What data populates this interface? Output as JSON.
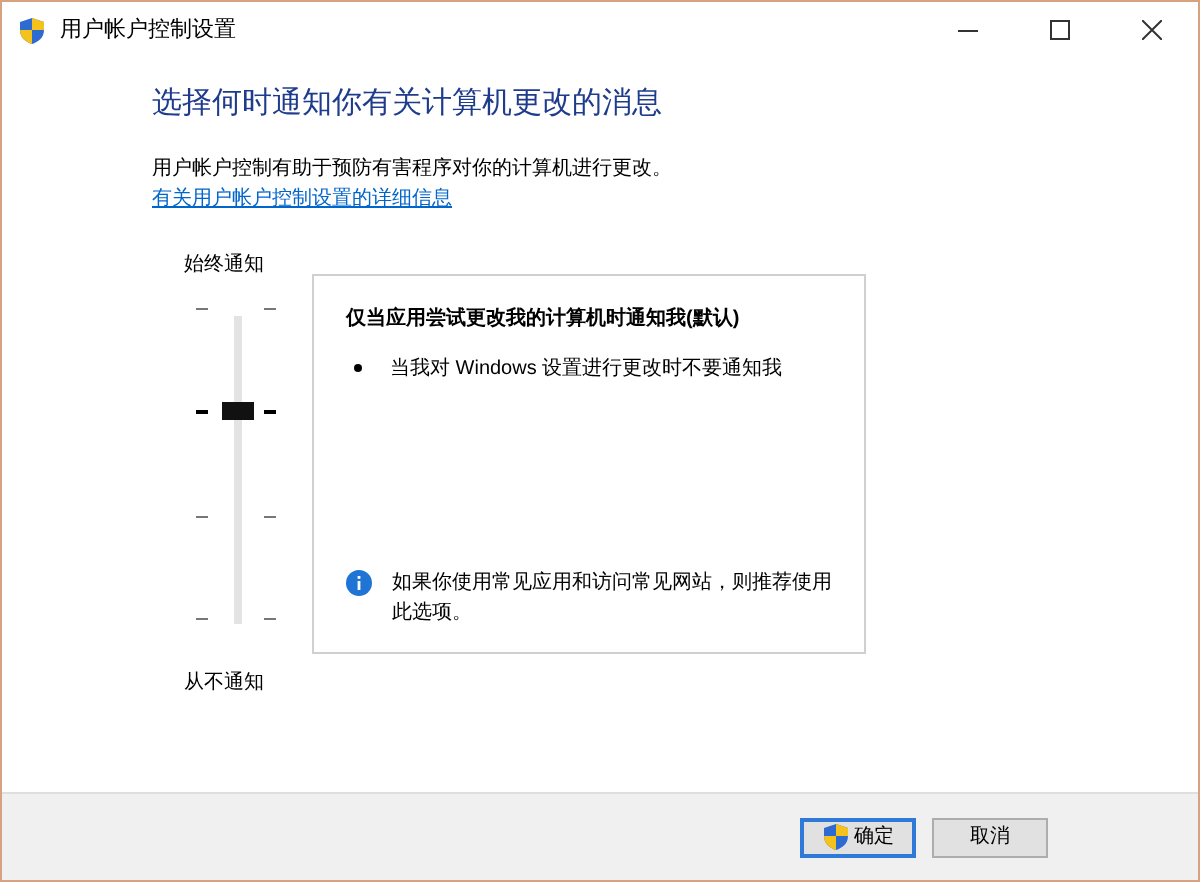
{
  "window": {
    "title": "用户帐户控制设置"
  },
  "heading": "选择何时通知你有关计算机更改的消息",
  "description": "用户帐户控制有助于预防有害程序对你的计算机进行更改。",
  "link": "有关用户帐户控制设置的详细信息",
  "slider": {
    "top_label": "始终通知",
    "bottom_label": "从不通知",
    "level": 0.67
  },
  "panel": {
    "title": "仅当应用尝试更改我的计算机时通知我(默认)",
    "bullets": [
      "当我对 Windows 设置进行更改时不要通知我"
    ],
    "info": "如果你使用常见应用和访问常见网站，则推荐使用此选项。"
  },
  "buttons": [
    {
      "label": "确定",
      "kind": "shield"
    },
    {
      "label": "取消",
      "kind": "plain"
    }
  ]
}
